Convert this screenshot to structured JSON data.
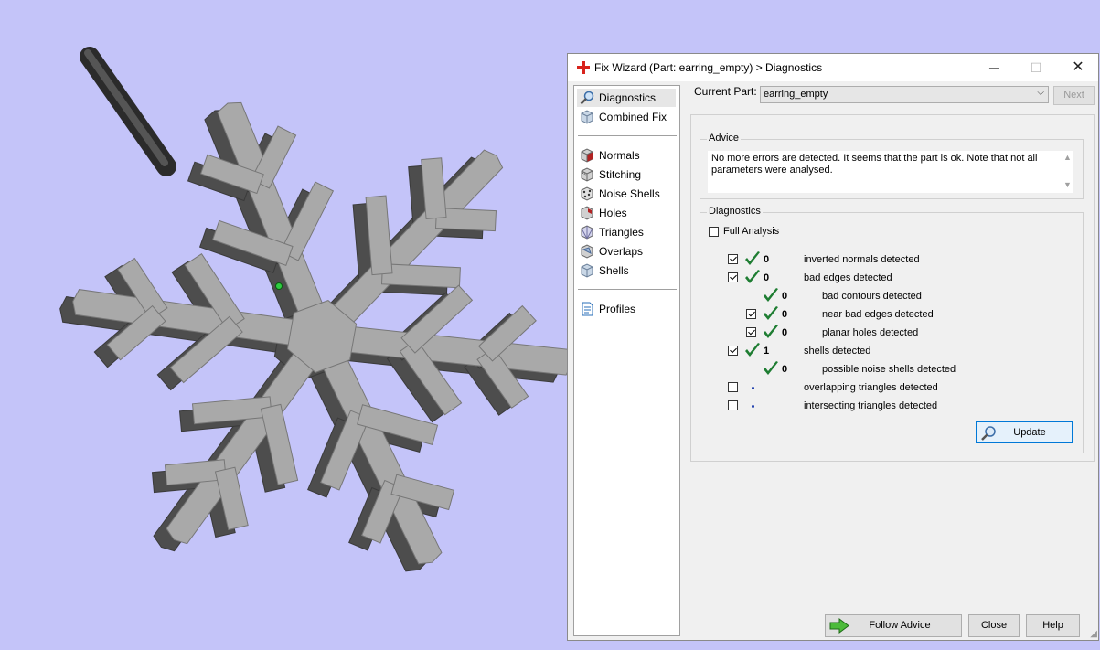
{
  "window": {
    "title": "Fix Wizard (Part: earring_empty) > Diagnostics",
    "icon": "red-cross-icon",
    "controls": {
      "minimize": "─",
      "maximize": "☐",
      "close": "✕"
    }
  },
  "sidebar": {
    "items": [
      {
        "label": "Diagnostics",
        "icon": "magnifier-icon",
        "selected": true
      },
      {
        "label": "Combined Fix",
        "icon": "cube-icon"
      },
      {
        "label": "Normals",
        "icon": "normals-cube-icon"
      },
      {
        "label": "Stitching",
        "icon": "stitching-cube-icon"
      },
      {
        "label": "Noise Shells",
        "icon": "noise-shells-icon"
      },
      {
        "label": "Holes",
        "icon": "holes-cube-icon"
      },
      {
        "label": "Triangles",
        "icon": "triangles-cube-icon"
      },
      {
        "label": "Overlaps",
        "icon": "overlaps-cube-icon"
      },
      {
        "label": "Shells",
        "icon": "shells-cube-icon"
      },
      {
        "label": "Profiles",
        "icon": "document-icon"
      }
    ]
  },
  "current_part": {
    "label": "Current Part:",
    "value": "earring_empty"
  },
  "next_label": "Next",
  "advice": {
    "title": "Advice",
    "text": "No more errors are detected. It seems that the part is ok. Note that not all parameters were analysed."
  },
  "diagnostics": {
    "title": "Diagnostics",
    "full_analysis": {
      "label": "Full Analysis",
      "checked": false
    },
    "rows": [
      {
        "checked": true,
        "status": "ok",
        "count": "0",
        "label": "inverted normals detected",
        "indent": 0
      },
      {
        "checked": true,
        "status": "ok",
        "count": "0",
        "label": "bad edges detected",
        "indent": 0
      },
      {
        "checked": null,
        "status": "ok",
        "count": "0",
        "label": "bad contours detected",
        "indent": 1
      },
      {
        "checked": true,
        "status": "ok",
        "count": "0",
        "label": "near bad edges detected",
        "indent": 1
      },
      {
        "checked": true,
        "status": "ok",
        "count": "0",
        "label": "planar holes detected",
        "indent": 1
      },
      {
        "checked": true,
        "status": "ok",
        "count": "1",
        "label": "shells detected",
        "indent": 0
      },
      {
        "checked": null,
        "status": "ok",
        "count": "0",
        "label": "possible noise shells detected",
        "indent": 1
      },
      {
        "checked": false,
        "status": "none",
        "count": "",
        "label": "overlapping triangles detected",
        "indent": 0
      },
      {
        "checked": false,
        "status": "none",
        "count": "",
        "label": "intersecting triangles detected",
        "indent": 0
      }
    ]
  },
  "buttons": {
    "update": "Update",
    "follow_advice": "Follow Advice",
    "close": "Close",
    "help": "Help"
  },
  "colors": {
    "viewport_bg": "#c4c4f9",
    "model_top": "#a9a9a9",
    "model_side": "#4d4d4d",
    "check_green": "#1e7d32",
    "accent": "#0078d7"
  }
}
